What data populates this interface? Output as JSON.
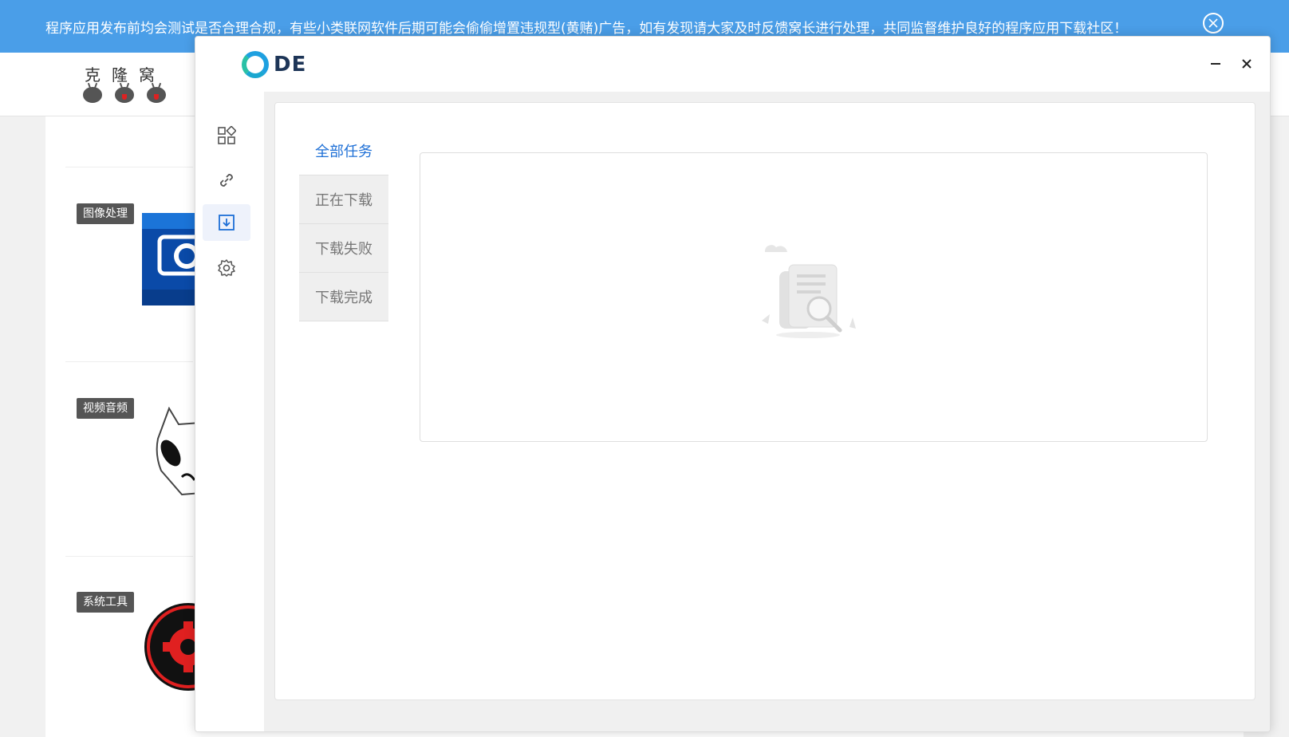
{
  "banner": {
    "text": "程序应用发布前均会测试是否合理合规，有些小类联网软件后期可能会偷偷增置违规型(黄赌)广告，如有发现请大家及时反馈窝长进行处理，共同监督维护良好的程序应用下载社区！"
  },
  "site": {
    "logo_text": "克隆窝",
    "categories": [
      {
        "label": "图像处理"
      },
      {
        "label": "视频音频"
      },
      {
        "label": "系统工具"
      }
    ]
  },
  "app": {
    "brand": "DE",
    "nav": [
      {
        "icon": "grid-icon"
      },
      {
        "icon": "link-icon"
      },
      {
        "icon": "download-icon"
      },
      {
        "icon": "gear-icon"
      }
    ],
    "tabs": [
      {
        "label": "全部任务"
      },
      {
        "label": "正在下载"
      },
      {
        "label": "下载失败"
      },
      {
        "label": "下载完成"
      }
    ],
    "active_tab": "全部任务"
  },
  "colors": {
    "banner": "#4a9ee8",
    "accent": "#1d6fd6",
    "nav_active_bg": "#eef2fb"
  }
}
